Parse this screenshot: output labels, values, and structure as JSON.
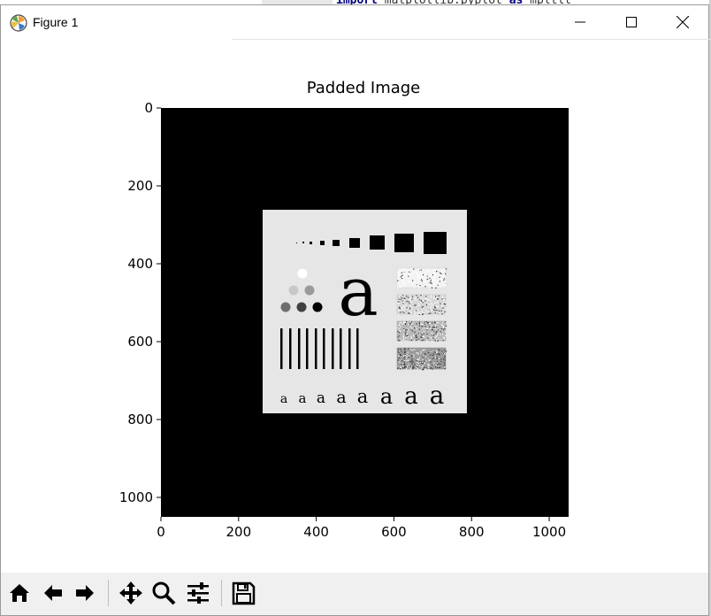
{
  "background": {
    "code_text_kw1": "import",
    "code_text_rest": " matplotlib.pyplot ",
    "code_text_kw2": "as",
    "code_text_tail": " mpltlt"
  },
  "window": {
    "title": "Figure 1",
    "icon": "matplotlib-icon",
    "controls": {
      "minimize": "minimize-icon",
      "maximize": "maximize-icon",
      "close": "close-icon"
    }
  },
  "plot": {
    "title": "Padded Image",
    "x_ticks": [
      "0",
      "200",
      "400",
      "600",
      "800",
      "1000"
    ],
    "y_ticks": [
      "0",
      "200",
      "400",
      "600",
      "800",
      "1000"
    ],
    "axis_limits": {
      "x": [
        0,
        1050
      ],
      "y": [
        0,
        1050
      ]
    },
    "image_extent": [
      0,
      1050
    ],
    "inner_image_extent": {
      "x": [
        262,
        788
      ],
      "y": [
        262,
        788
      ]
    },
    "colors": {
      "padding": "#000000",
      "inner_background": "#e6e6e6"
    }
  },
  "toolbar": {
    "buttons": [
      {
        "name": "home-icon"
      },
      {
        "name": "back-icon"
      },
      {
        "name": "forward-icon"
      },
      {
        "name": "pan-icon"
      },
      {
        "name": "zoom-icon"
      },
      {
        "name": "configure-subplots-icon"
      },
      {
        "name": "save-icon"
      }
    ]
  }
}
